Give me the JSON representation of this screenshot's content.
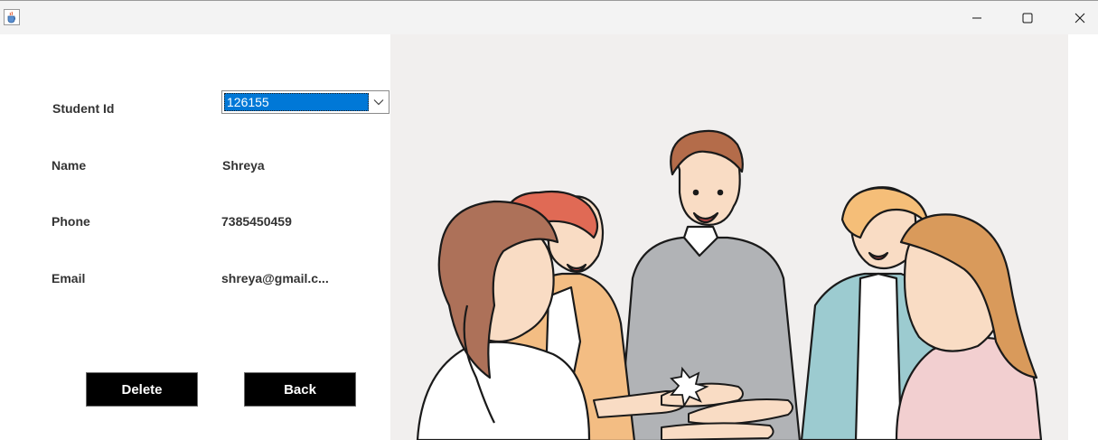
{
  "window": {
    "icon": "java-cup-icon",
    "controls": {
      "minimize_icon": "minimize-icon",
      "maximize_icon": "maximize-icon",
      "close_icon": "close-icon"
    }
  },
  "form": {
    "student_id": {
      "label": "Student Id",
      "selected": "126155"
    },
    "name": {
      "label": "Name",
      "value": "Shreya"
    },
    "phone": {
      "label": "Phone",
      "value": "7385450459"
    },
    "email": {
      "label": "Email",
      "value": "shreya@gmail.c..."
    }
  },
  "buttons": {
    "delete": "Delete",
    "back": "Back"
  },
  "colors": {
    "selection": "#0078d7",
    "button_bg": "#000000",
    "button_text": "#ffffff",
    "illustration_bg": "#f1efee"
  }
}
